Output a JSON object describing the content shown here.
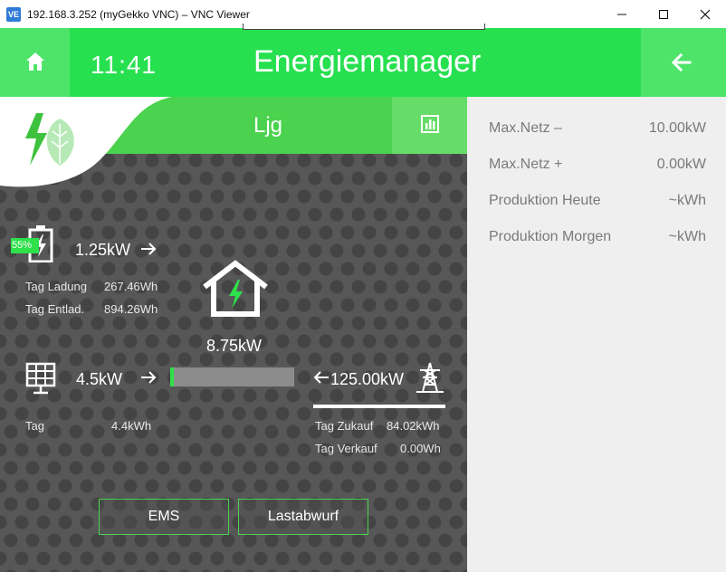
{
  "window": {
    "app_icon": "VE",
    "title": "192.168.3.252 (myGekko VNC) – VNC Viewer",
    "icons": [
      "minimize-icon",
      "maximize-icon",
      "close-icon"
    ]
  },
  "header": {
    "time": "11:41",
    "title": "Energiemanager",
    "icons": [
      "home-icon",
      "back-arrow-icon"
    ]
  },
  "subheader": {
    "room": "Ljg",
    "icons": [
      "leaf-lightning-logo-icon",
      "bar-chart-icon"
    ]
  },
  "battery": {
    "percent": "55%",
    "percent_value": 55,
    "power": "1.25kW",
    "charge_label": "Tag Ladung",
    "charge_value": "267.46Wh",
    "discharge_label": "Tag Entlad.",
    "discharge_value": "894.26Wh",
    "icons": [
      "battery-charging-icon",
      "arrow-right-icon"
    ]
  },
  "house": {
    "power": "8.75kW",
    "icons": [
      "house-lightning-icon"
    ]
  },
  "solar": {
    "power": "4.5kW",
    "day_label": "Tag",
    "day_value": "4.4kWh",
    "progress_fraction": 0.03,
    "icons": [
      "solar-panel-icon",
      "arrow-right-icon"
    ]
  },
  "grid": {
    "power": "125.00kW",
    "buy_label": "Tag Zukauf",
    "buy_value": "84.02kWh",
    "sell_label": "Tag Verkauf",
    "sell_value": "0.00Wh",
    "icons": [
      "arrow-left-icon",
      "power-tower-icon"
    ]
  },
  "buttons": {
    "ems": "EMS",
    "load_shedding": "Lastabwurf"
  },
  "info": [
    {
      "label": "Max.Netz –",
      "value": "10.00kW"
    },
    {
      "label": "Max.Netz +",
      "value": "0.00kW"
    },
    {
      "label": "Produktion Heute",
      "value": "~kWh"
    },
    {
      "label": "Produktion Morgen",
      "value": "~kWh"
    }
  ],
  "colors": {
    "accent_green": "#27e050",
    "accent_green_light": "#4ee46a",
    "subheader_green": "#4bd24e",
    "panel_dark": "#575757",
    "panel_light": "#efefef"
  }
}
